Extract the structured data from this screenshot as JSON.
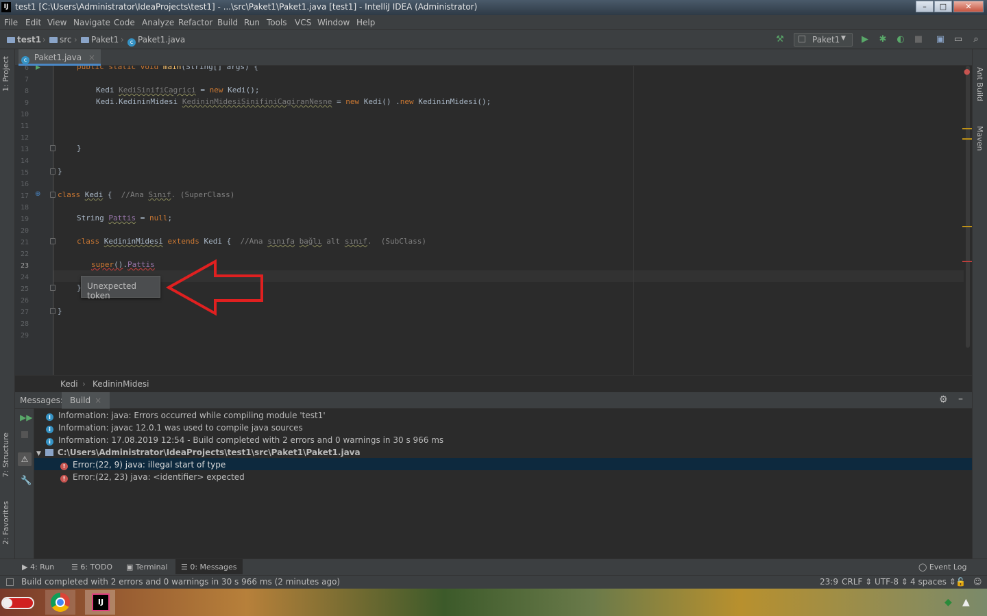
{
  "window": {
    "title": "test1 [C:\\Users\\Administrator\\IdeaProjects\\test1] - ...\\src\\Paket1\\Paket1.java [test1] - IntelliJ IDEA (Administrator)",
    "logo": "IJ"
  },
  "menu": [
    "File",
    "Edit",
    "View",
    "Navigate",
    "Code",
    "Analyze",
    "Refactor",
    "Build",
    "Run",
    "Tools",
    "VCS",
    "Window",
    "Help"
  ],
  "navbar": {
    "crumbs": [
      "test1",
      "src",
      "Paket1",
      "Paket1.java"
    ],
    "run_config": "Paket1"
  },
  "editor": {
    "tab_label": "Paket1.java",
    "line_numbers": [
      "6",
      "7",
      "8",
      "9",
      "10",
      "11",
      "12",
      "13",
      "14",
      "15",
      "16",
      "17",
      "18",
      "19",
      "20",
      "21",
      "22",
      "23",
      "24",
      "25",
      "26",
      "27",
      "28",
      "29"
    ],
    "tooltip": "Unexpected token",
    "breadcrumbs": [
      "Kedi",
      "KedininMidesi"
    ]
  },
  "left_tabs": [
    "1: Project",
    "7: Structure",
    "2: Favorites"
  ],
  "right_tabs": [
    "Ant Build",
    "Maven"
  ],
  "messages": {
    "header_label": "Messages:",
    "tab": "Build",
    "lines": [
      "Information: java: Errors occurred while compiling module 'test1'",
      "Information: javac 12.0.1 was used to compile java sources",
      "Information: 17.08.2019 12:54 - Build completed with 2 errors and 0 warnings in 30 s 966 ms"
    ],
    "file": "C:\\Users\\Administrator\\IdeaProjects\\test1\\src\\Paket1\\Paket1.java",
    "errors": [
      "Error:(22, 9)  java: illegal start of type",
      "Error:(22, 23)  java: <identifier> expected"
    ]
  },
  "bottom_tabs": [
    "4: Run",
    "6: TODO",
    "Terminal",
    "0: Messages"
  ],
  "event_log": "Event Log",
  "status": {
    "message": "Build completed with 2 errors and 0 warnings in 30 s 966 ms (2 minutes ago)",
    "position": "23:9",
    "line_sep": "CRLF",
    "encoding": "UTF-8",
    "indent": "4 spaces"
  },
  "colors": {
    "accent": "#4a88c7",
    "error": "#c75450",
    "info": "#3592c4",
    "arrow": "#e02020"
  }
}
